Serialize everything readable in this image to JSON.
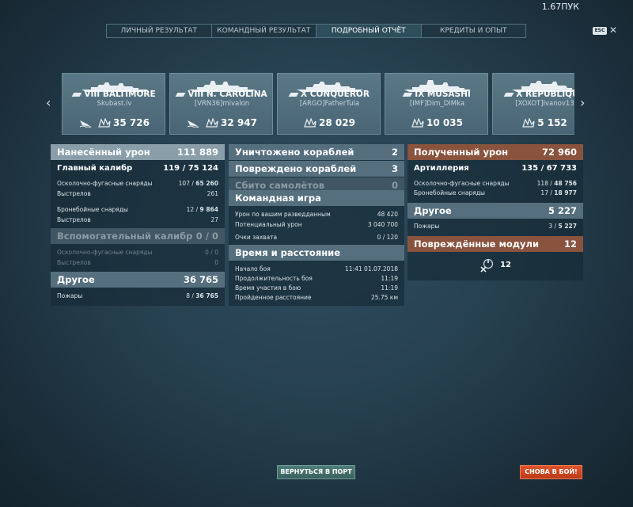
{
  "version": "1.67ПУК",
  "tabs": [
    {
      "label": "ЛИЧНЫЙ РЕЗУЛЬТАТ"
    },
    {
      "label": "КОМАНДНЫЙ РЕЗУЛЬТАТ"
    },
    {
      "label": "ПОДРОБНЫЙ ОТЧЁТ"
    },
    {
      "label": "КРЕДИТЫ И ОПЫТ"
    }
  ],
  "active_tab": "ПОДРОБНЫЙ ОТЧЁТ",
  "esc_label": "ESC",
  "close_glyph": "✕",
  "nav": {
    "prev_glyph": "‹",
    "next_glyph": "›"
  },
  "ships": [
    {
      "name": "VIII BALTIMORE",
      "player": "Skubast.iv",
      "damage": "35 726"
    },
    {
      "name": "VIII N. CAROLINA",
      "player": "[VRN36]mivalon",
      "damage": "32 947"
    },
    {
      "name": "X CONQUEROR",
      "player": "[ARGO]FatherTula",
      "damage": "28 029"
    },
    {
      "name": "IX MUSASHI",
      "player": "[IMF]Dim_DIMka",
      "damage": "10 035"
    },
    {
      "name": "X RÉPUBLIQUE",
      "player": "[XOXOT]Ivanov13",
      "damage": "5 152"
    }
  ],
  "left": {
    "dealt_label": "Нанесённый урон",
    "dealt_value": "111 889",
    "main_label": "Главный калибр",
    "main_hits": "119 /",
    "main_value": "75 124",
    "he_label": "Осколочно-фугасные снаряды",
    "he_hits": "107 /",
    "he_value": "65 260",
    "he_shots_label": "Выстрелов",
    "he_shots": "261",
    "ap_label": "Бронебойные снаряды",
    "ap_hits": "12 /",
    "ap_value": "9 864",
    "ap_shots_label": "Выстрелов",
    "ap_shots": "27",
    "sec_label": "Вспомогательный калибр",
    "sec_value": "0 / 0",
    "sec_he_label": "Осколочно-фугасные снаряды",
    "sec_he_value": "0 / 0",
    "sec_shots_label": "Выстрелов",
    "sec_shots": "0",
    "other_label": "Другое",
    "other_value": "36 765",
    "fires_label": "Пожары",
    "fires_hits": "8 /",
    "fires_value": "36 765"
  },
  "mid": {
    "destroyed_label": "Уничтожено кораблей",
    "destroyed_value": "2",
    "damaged_label": "Повреждено кораблей",
    "damaged_value": "3",
    "planes_label": "Сбито самолётов",
    "planes_value": "0",
    "team_label": "Командная игра",
    "spotted_label": "Урон по вашим разведданным",
    "spotted_value": "48 420",
    "potential_label": "Потенциальный урон",
    "potential_value": "3 040 700",
    "capture_label": "Очки захвата",
    "capture_value": "0 / 120",
    "time_label": "Время и расстояние",
    "start_label": "Начало боя",
    "start_value": "11:41  01.07.2018",
    "duration_label": "Продолжительность боя",
    "duration_value": "11:19",
    "participation_label": "Время участия в бою",
    "participation_value": "11:19",
    "distance_label": "Пройденное расстояние",
    "distance_value": "25.75 км"
  },
  "right": {
    "received_label": "Полученный урон",
    "received_value": "72 960",
    "art_label": "Артиллерия",
    "art_hits": "135 /",
    "art_value": "67 733",
    "he_label": "Осколочно-фугасные снаряды",
    "he_hits": "118 /",
    "he_value": "48 756",
    "ap_label": "Бронебойные снаряды",
    "ap_hits": "17 /",
    "ap_value": "18 977",
    "other_label": "Другое",
    "other_value": "5 227",
    "fires_label": "Пожары",
    "fires_hits": "3 /",
    "fires_value": "5 227",
    "modules_label": "Повреждённые модули",
    "modules_value": "12",
    "modules_count": "12"
  },
  "buttons": {
    "port": "ВЕРНУТЬСЯ В ПОРТ",
    "battle": "СНОВА В БОЙ!"
  }
}
